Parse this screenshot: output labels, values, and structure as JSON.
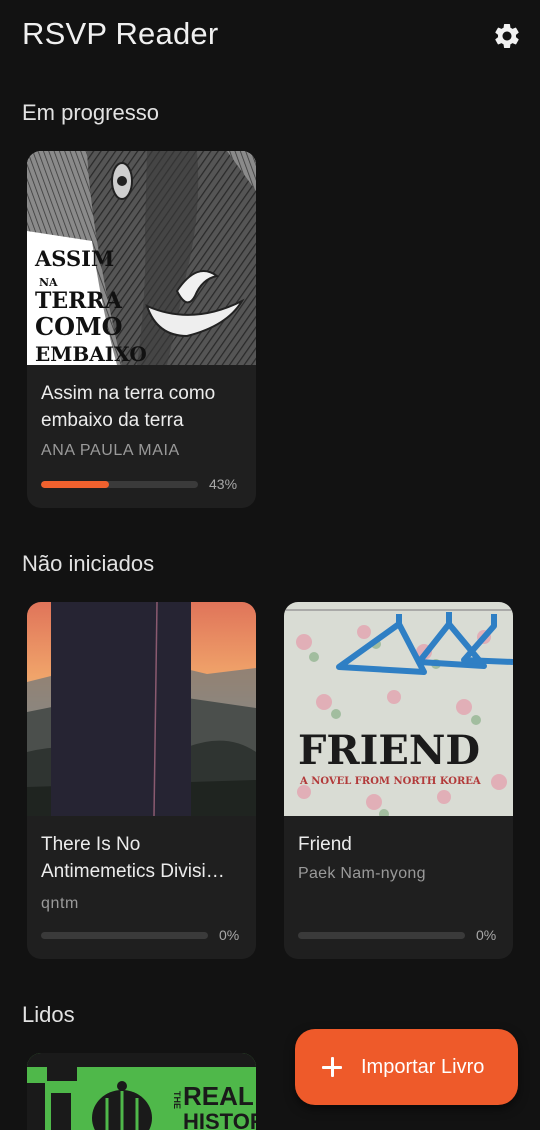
{
  "header": {
    "title": "RSVP Reader",
    "settings_icon": "gear-icon"
  },
  "sections": {
    "in_progress": {
      "title": "Em progresso",
      "books": [
        {
          "title": "Assim na terra como embaixo da terra",
          "author": "ANA PAULA MAIA",
          "progress": 0.43,
          "progress_label": "43%",
          "cover_text": [
            "ASSIM",
            "NA",
            "TERRA",
            "COMO",
            "EMBAIXO"
          ]
        }
      ]
    },
    "not_started": {
      "title": "Não iniciados",
      "books": [
        {
          "title": "There Is No Antimemetics Divisi…",
          "author": "qntm",
          "progress": 0,
          "progress_label": "0%"
        },
        {
          "title": "Friend",
          "author": "Paek Nam-nyong",
          "progress": 0,
          "progress_label": "0%",
          "cover_text": [
            "FRIEND",
            "A NOVEL FROM NORTH KOREA"
          ]
        }
      ]
    },
    "read": {
      "title": "Lidos",
      "books": [
        {
          "cover_text": [
            "THE",
            "REAL",
            "HISTORY"
          ]
        }
      ]
    }
  },
  "fab": {
    "label": "Importar Livro",
    "icon": "plus-icon"
  },
  "colors": {
    "background": "#121212",
    "card": "#1f1f1f",
    "accent": "#ee5a2a",
    "progress_track": "#3a3a3a"
  }
}
